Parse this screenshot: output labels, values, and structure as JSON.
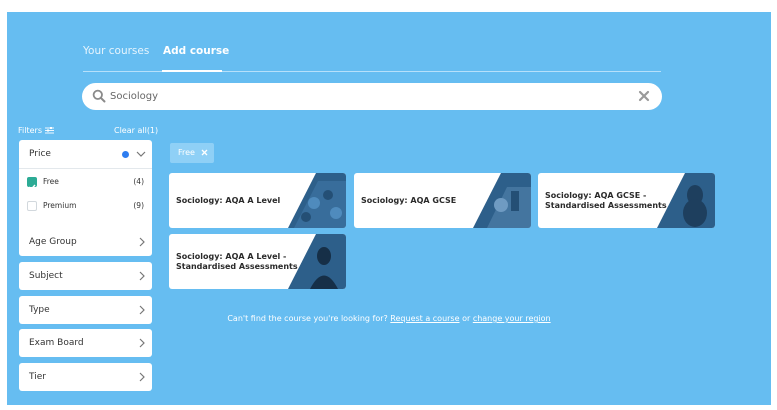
{
  "tabs": [
    {
      "label": "Your courses",
      "active": false
    },
    {
      "label": "Add course",
      "active": true
    }
  ],
  "search": {
    "value": "Sociology",
    "icon": "search-icon",
    "clear_icon": "close-icon"
  },
  "filters": {
    "label": "Filters",
    "clear_all": "Clear all(1)",
    "price": {
      "label": "Price",
      "options": [
        {
          "label": "Free",
          "count": "(4)",
          "checked": true
        },
        {
          "label": "Premium",
          "count": "(9)",
          "checked": false
        }
      ]
    },
    "groups": [
      "Age Group",
      "Subject",
      "Type",
      "Exam Board",
      "Tier"
    ]
  },
  "active_filter": {
    "label": "Free"
  },
  "courses": [
    {
      "title_line1": "Sociology: AQA A Level",
      "title_line2": ""
    },
    {
      "title_line1": "Sociology: AQA GCSE",
      "title_line2": ""
    },
    {
      "title_line1": "Sociology: AQA GCSE -",
      "title_line2": "Standardised Assessments"
    },
    {
      "title_line1": "Sociology: AQA A Level -",
      "title_line2": "Standardised Assessments"
    }
  ],
  "footer": {
    "prefix": "Can't find the course you're looking for?",
    "link1": "Request a course",
    "middle": "or",
    "link2": "change your region"
  },
  "colors": {
    "background": "#66bdf1",
    "accent": "#2e7df0",
    "checkbox": "#2cab95",
    "image_tint": "#2d5f8a"
  }
}
